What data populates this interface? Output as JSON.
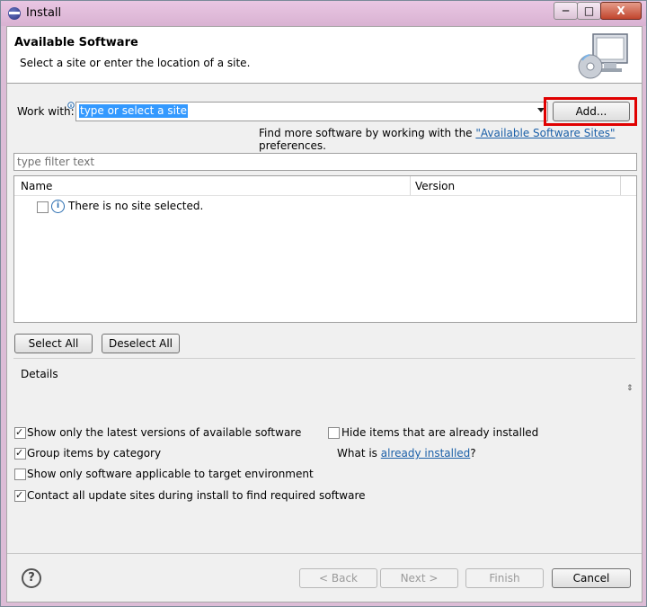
{
  "window": {
    "title": "Install",
    "minimize_label": "─",
    "maximize_label": "□",
    "close_label": "X"
  },
  "header": {
    "title": "Available Software",
    "description": "Select a site or enter the location of a site."
  },
  "work_with": {
    "label": "Work with:",
    "input_text": "type or select a site",
    "add_button": "Add..."
  },
  "find_more": {
    "prefix": "Find more software by working with the ",
    "link": "\"Available Software Sites\"",
    "suffix": " preferences."
  },
  "filter": {
    "placeholder": "type filter text"
  },
  "table": {
    "columns": [
      "Name",
      "Version"
    ],
    "rows": [
      {
        "name": "There is no site selected.",
        "checked": false
      }
    ]
  },
  "selection_buttons": {
    "select_all": "Select All",
    "deselect_all": "Deselect All"
  },
  "details": {
    "label": "Details"
  },
  "options": {
    "latest_versions": {
      "label": "Show only the latest versions of available software",
      "checked": true
    },
    "group_by_category": {
      "label": "Group items by category",
      "checked": true
    },
    "target_env": {
      "label": "Show only software applicable to target environment",
      "checked": false
    },
    "contact_sites": {
      "label": "Contact all update sites during install to find required software",
      "checked": true
    },
    "hide_installed": {
      "label": "Hide items that are already installed",
      "checked": false
    },
    "what_is_prefix": "What is ",
    "what_is_link": "already installed",
    "what_is_suffix": "?"
  },
  "footer": {
    "back": "< Back",
    "next": "Next >",
    "finish": "Finish",
    "cancel": "Cancel"
  },
  "colors": {
    "frame": "#dcbcd6",
    "selection": "#3399ff",
    "highlight_box": "#e00000",
    "link": "#1a5fa8"
  }
}
